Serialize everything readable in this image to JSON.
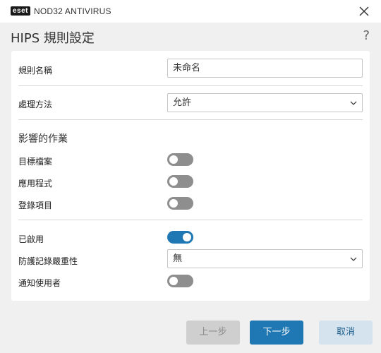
{
  "titlebar": {
    "logo_text": "eset",
    "app_name": "NOD32 ANTIVIRUS"
  },
  "header": {
    "title": "HIPS 規則設定",
    "help": "?"
  },
  "form": {
    "rule_name_label": "規則名稱",
    "rule_name_value": "未命名",
    "action_label": "處理方法",
    "action_value": "允許",
    "affected_ops_title": "影響的作業",
    "target_files_label": "目標檔案",
    "target_files_on": false,
    "applications_label": "應用程式",
    "applications_on": false,
    "registry_label": "登錄項目",
    "registry_on": false,
    "enabled_label": "已啟用",
    "enabled_on": true,
    "log_severity_label": "防護記錄嚴重性",
    "log_severity_value": "無",
    "notify_user_label": "通知使用者",
    "notify_user_on": false
  },
  "buttons": {
    "prev": "上一步",
    "next": "下一步",
    "cancel": "取消"
  },
  "colors": {
    "accent": "#1f78b4",
    "toggle_off": "#8e8e8e"
  }
}
